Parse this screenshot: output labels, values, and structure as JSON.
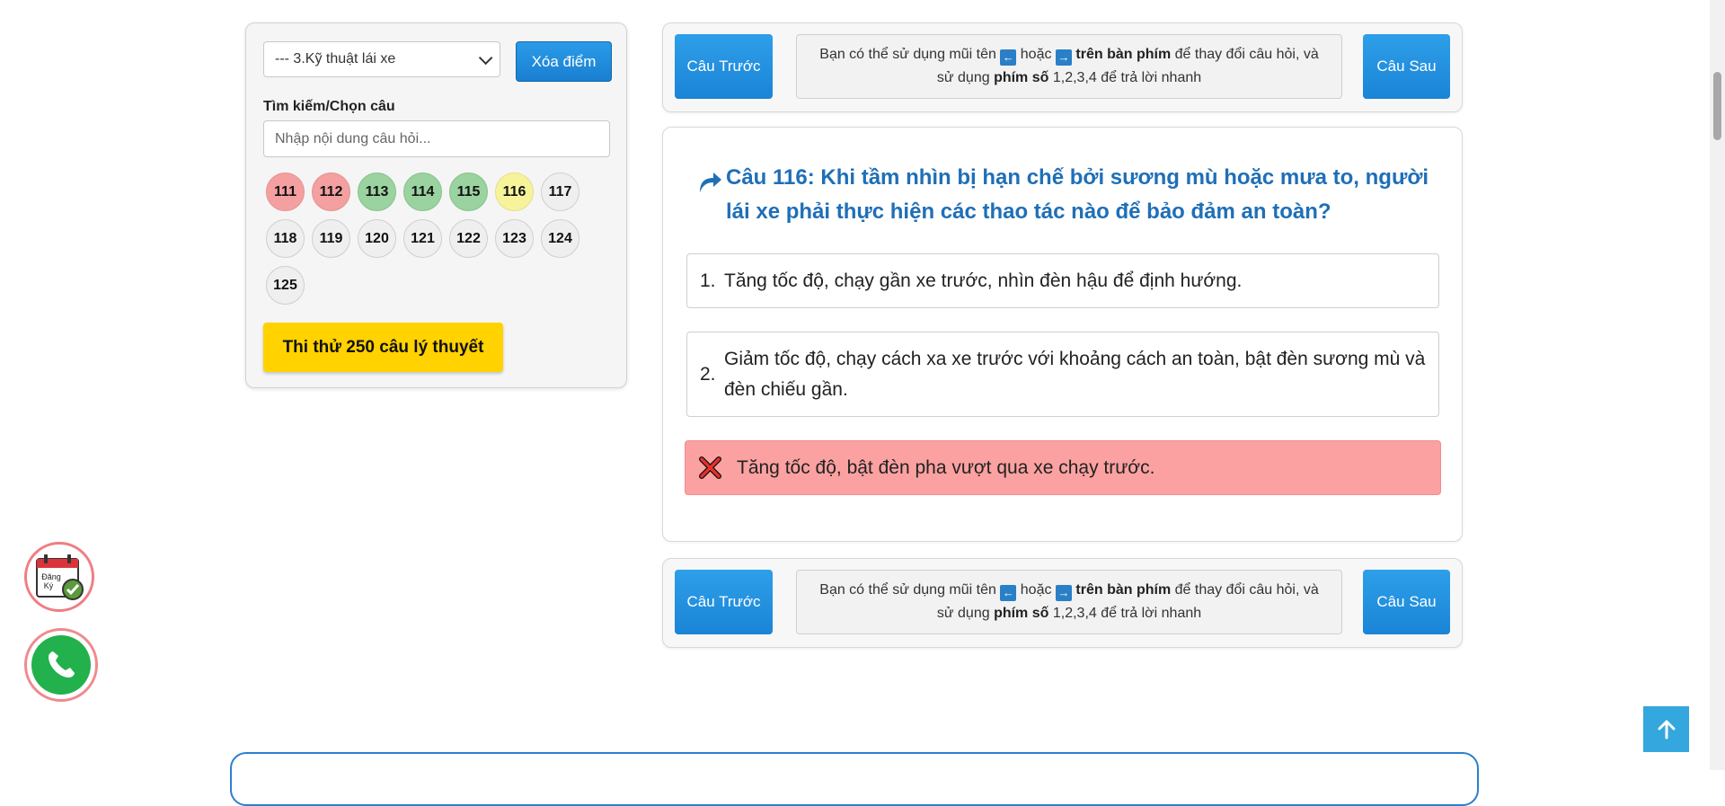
{
  "sidebar": {
    "topic_select": "--- 3.Kỹ thuật lái xe",
    "clear_label": "Xóa điểm",
    "search_label": "Tìm kiếm/Chọn câu",
    "search_placeholder": "Nhập nội dung câu hỏi...",
    "questions": [
      {
        "n": "111",
        "state": "wrong"
      },
      {
        "n": "112",
        "state": "wrong"
      },
      {
        "n": "113",
        "state": "right"
      },
      {
        "n": "114",
        "state": "right"
      },
      {
        "n": "115",
        "state": "right"
      },
      {
        "n": "116",
        "state": "current"
      },
      {
        "n": "117",
        "state": "none"
      },
      {
        "n": "118",
        "state": "none"
      },
      {
        "n": "119",
        "state": "none"
      },
      {
        "n": "120",
        "state": "none"
      },
      {
        "n": "121",
        "state": "none"
      },
      {
        "n": "122",
        "state": "none"
      },
      {
        "n": "123",
        "state": "none"
      },
      {
        "n": "124",
        "state": "none"
      },
      {
        "n": "125",
        "state": "none"
      }
    ],
    "trial_label": "Thi thử 250 câu lý thuyết"
  },
  "nav": {
    "prev_label": "Câu Trước",
    "next_label": "Câu Sau",
    "hint_part1": "Bạn có thể sử dụng mũi tên",
    "key_left": "←",
    "hint_or": "hoặc",
    "key_right": "→",
    "hint_keyboard": "trên bàn phím",
    "hint_part2": "để thay đổi câu hỏi, và",
    "hint_part3": "sử dụng",
    "hint_numkeys": "phím số",
    "hint_part4": "1,2,3,4 để trả lời nhanh"
  },
  "question": {
    "title": "Câu 116: Khi tầm nhìn bị hạn chế bởi sương mù hoặc mưa to, người lái xe phải thực hiện các thao tác nào để bảo đảm an toàn?",
    "options": [
      {
        "num": "1.",
        "text": "Tăng tốc độ, chạy gần xe trước, nhìn đèn hậu để định hướng."
      },
      {
        "num": "2.",
        "text": "Giảm tốc độ, chạy cách xa xe trước với khoảng cách an toàn, bật đèn sương mù và đèn chiếu gần."
      },
      {
        "num": "",
        "text": "Tăng tốc độ, bật đèn pha vượt qua xe chạy trước."
      }
    ]
  },
  "floating": {
    "register_text_1": "Đăng",
    "register_text_2": "Ký"
  },
  "colors": {
    "wrong": "#f4a0a0",
    "right": "#9ad39f",
    "current": "#f6f39a",
    "accent": "#1a84d6",
    "title": "#1f6fb7",
    "trial": "#ffd200"
  }
}
